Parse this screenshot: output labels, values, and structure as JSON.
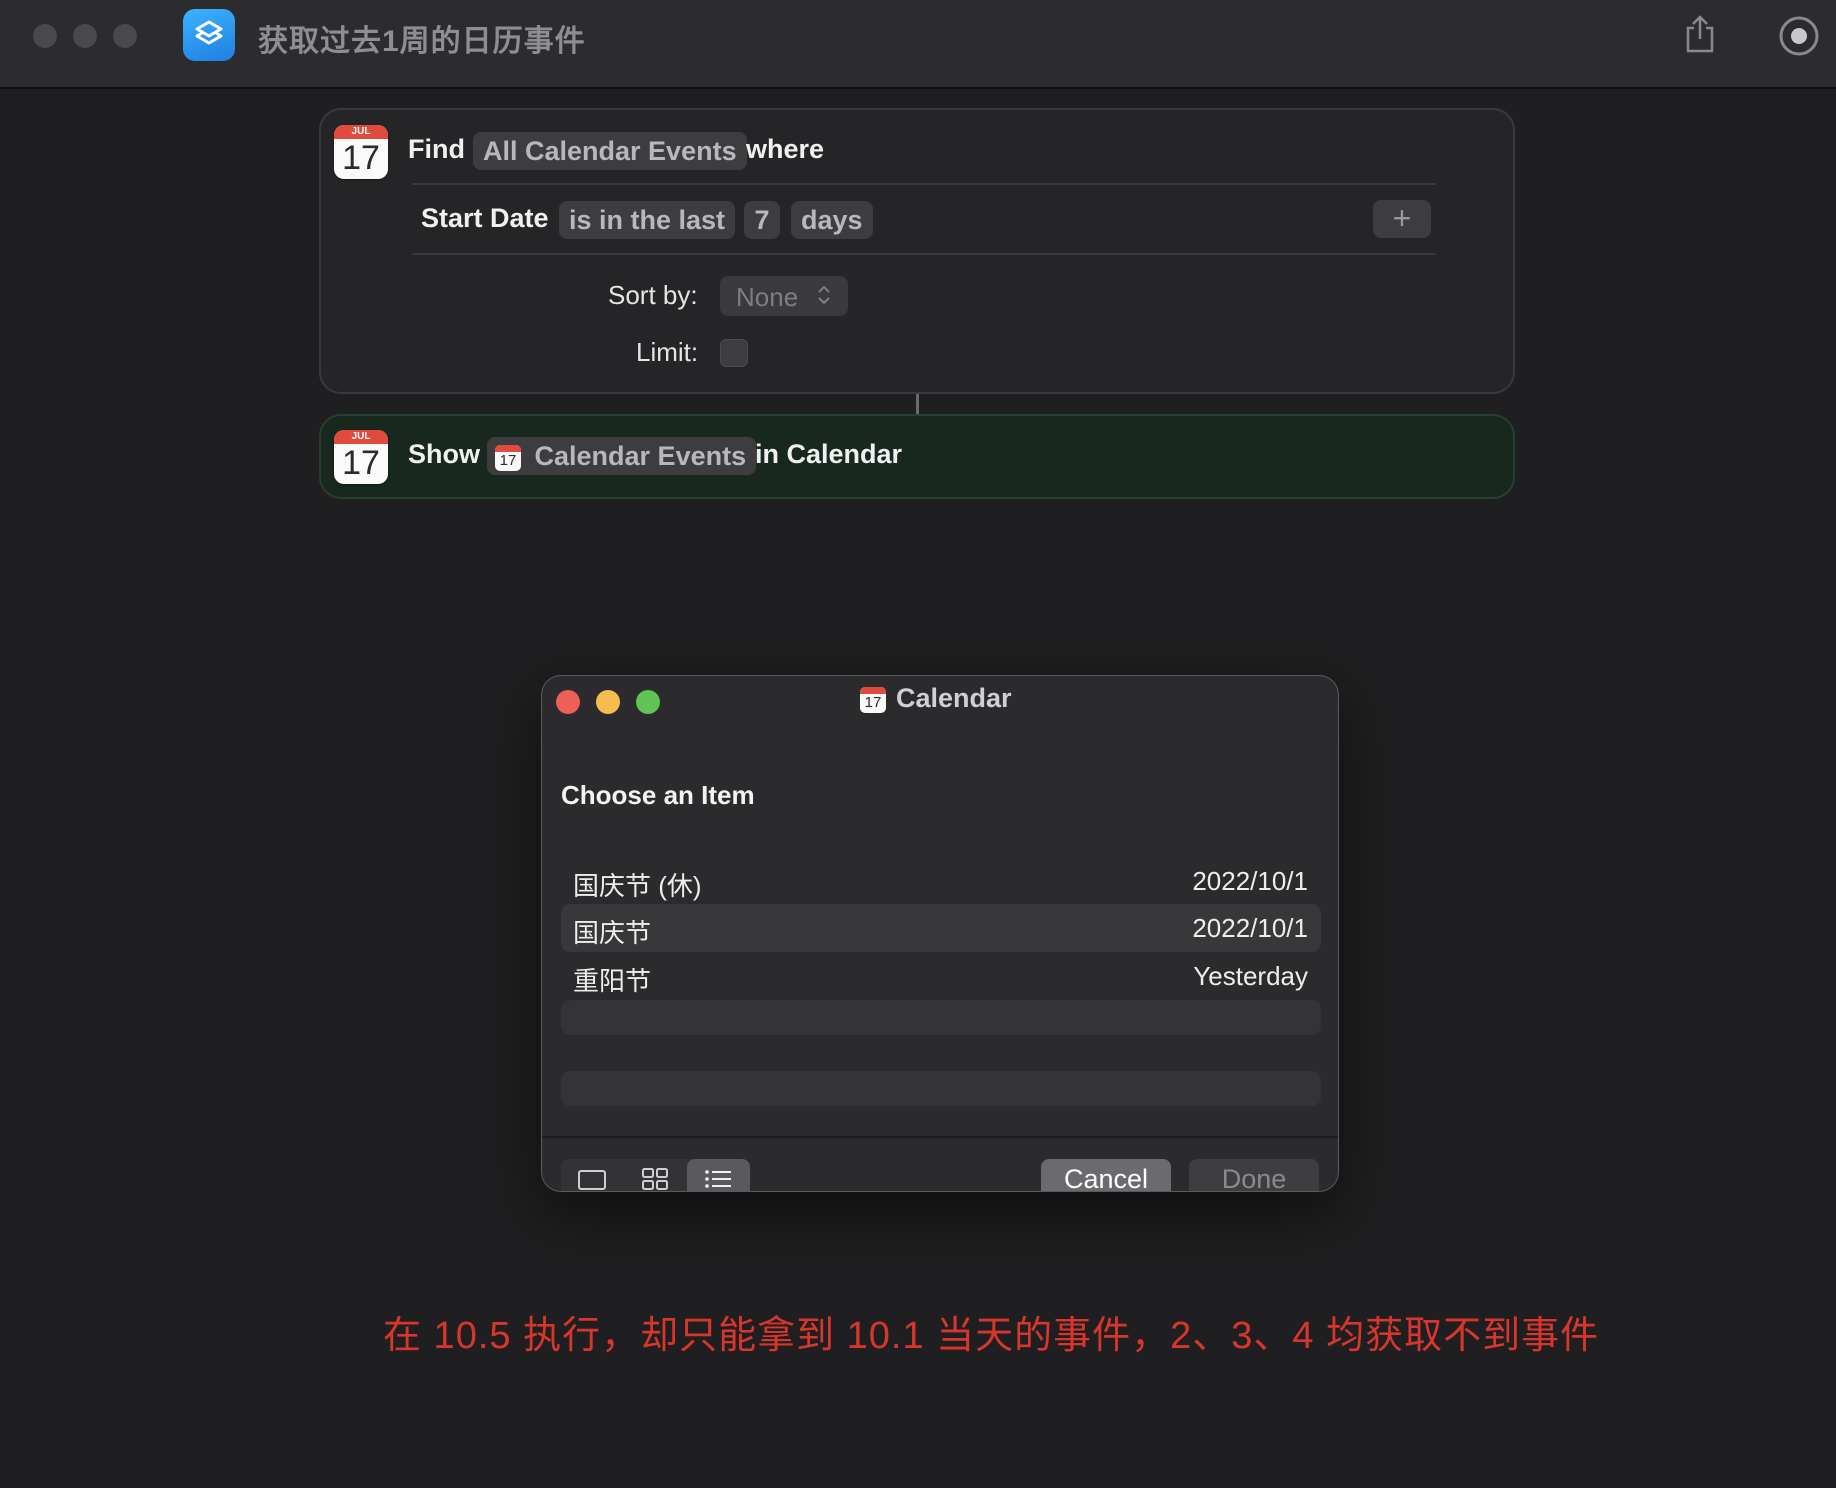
{
  "window": {
    "title": "获取过去1周的日历事件"
  },
  "find_action": {
    "icon": {
      "month": "JUL",
      "day": "17"
    },
    "find_label": "Find",
    "source_token": "All Calendar Events",
    "where_label": "where",
    "filter": {
      "field": "Start Date",
      "operator": "is in the last",
      "amount": "7",
      "unit": "days",
      "add_label": "+"
    },
    "sort_label": "Sort by:",
    "sort_value": "None",
    "limit_label": "Limit:",
    "limit_checked": false
  },
  "show_action": {
    "icon": {
      "month": "JUL",
      "day": "17"
    },
    "show_label": "Show",
    "variable_token": "Calendar Events",
    "in_label": "in Calendar"
  },
  "dialog": {
    "title": "Calendar",
    "heading": "Choose an Item",
    "items": [
      {
        "name": "国庆节 (休)",
        "date": "2022/10/1"
      },
      {
        "name": "国庆节",
        "date": "2022/10/1"
      },
      {
        "name": "重阳节",
        "date": "Yesterday"
      }
    ],
    "cancel_label": "Cancel",
    "done_label": "Done",
    "view_modes": [
      "single-view",
      "grid-view",
      "list-view"
    ],
    "selected_view": "list-view"
  },
  "annotation": "在 10.5 执行，却只能拿到 10.1 当天的事件，2、3、4 均获取不到事件",
  "colors": {
    "annotation": "#d8362c",
    "show_card_bg": "#18281f",
    "traffic_close": "#ed5f57",
    "traffic_minimize": "#f5bd4f",
    "traffic_zoom": "#5fc454"
  }
}
